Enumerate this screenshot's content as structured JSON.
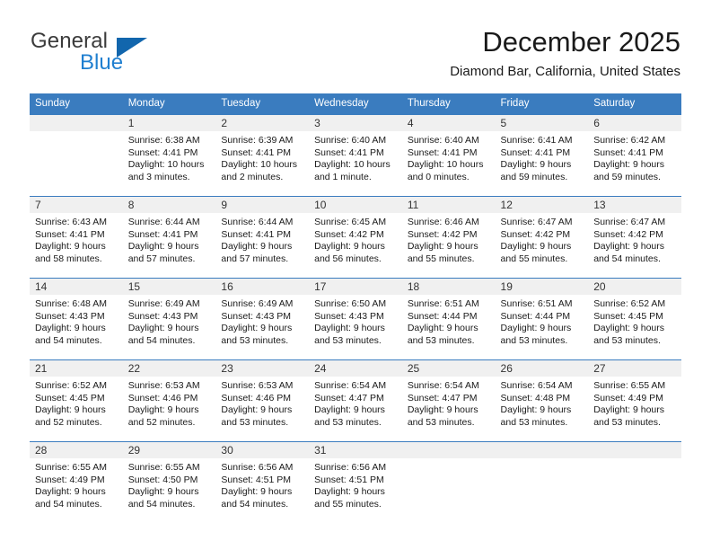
{
  "brand": {
    "name_part1": "General",
    "name_part2": "Blue",
    "logo_icon": "blue-triangle-logo"
  },
  "header": {
    "month_title": "December 2025",
    "location": "Diamond Bar, California, United States"
  },
  "calendar": {
    "weekday_headers": [
      "Sunday",
      "Monday",
      "Tuesday",
      "Wednesday",
      "Thursday",
      "Friday",
      "Saturday"
    ],
    "accent_color": "#3a7cbf",
    "band_color": "#f0f0f0",
    "weeks": [
      [
        {
          "day": "",
          "sunrise": "",
          "sunset": "",
          "daylight_line1": "",
          "daylight_line2": ""
        },
        {
          "day": "1",
          "sunrise": "Sunrise: 6:38 AM",
          "sunset": "Sunset: 4:41 PM",
          "daylight_line1": "Daylight: 10 hours",
          "daylight_line2": "and 3 minutes."
        },
        {
          "day": "2",
          "sunrise": "Sunrise: 6:39 AM",
          "sunset": "Sunset: 4:41 PM",
          "daylight_line1": "Daylight: 10 hours",
          "daylight_line2": "and 2 minutes."
        },
        {
          "day": "3",
          "sunrise": "Sunrise: 6:40 AM",
          "sunset": "Sunset: 4:41 PM",
          "daylight_line1": "Daylight: 10 hours",
          "daylight_line2": "and 1 minute."
        },
        {
          "day": "4",
          "sunrise": "Sunrise: 6:40 AM",
          "sunset": "Sunset: 4:41 PM",
          "daylight_line1": "Daylight: 10 hours",
          "daylight_line2": "and 0 minutes."
        },
        {
          "day": "5",
          "sunrise": "Sunrise: 6:41 AM",
          "sunset": "Sunset: 4:41 PM",
          "daylight_line1": "Daylight: 9 hours",
          "daylight_line2": "and 59 minutes."
        },
        {
          "day": "6",
          "sunrise": "Sunrise: 6:42 AM",
          "sunset": "Sunset: 4:41 PM",
          "daylight_line1": "Daylight: 9 hours",
          "daylight_line2": "and 59 minutes."
        }
      ],
      [
        {
          "day": "7",
          "sunrise": "Sunrise: 6:43 AM",
          "sunset": "Sunset: 4:41 PM",
          "daylight_line1": "Daylight: 9 hours",
          "daylight_line2": "and 58 minutes."
        },
        {
          "day": "8",
          "sunrise": "Sunrise: 6:44 AM",
          "sunset": "Sunset: 4:41 PM",
          "daylight_line1": "Daylight: 9 hours",
          "daylight_line2": "and 57 minutes."
        },
        {
          "day": "9",
          "sunrise": "Sunrise: 6:44 AM",
          "sunset": "Sunset: 4:41 PM",
          "daylight_line1": "Daylight: 9 hours",
          "daylight_line2": "and 57 minutes."
        },
        {
          "day": "10",
          "sunrise": "Sunrise: 6:45 AM",
          "sunset": "Sunset: 4:42 PM",
          "daylight_line1": "Daylight: 9 hours",
          "daylight_line2": "and 56 minutes."
        },
        {
          "day": "11",
          "sunrise": "Sunrise: 6:46 AM",
          "sunset": "Sunset: 4:42 PM",
          "daylight_line1": "Daylight: 9 hours",
          "daylight_line2": "and 55 minutes."
        },
        {
          "day": "12",
          "sunrise": "Sunrise: 6:47 AM",
          "sunset": "Sunset: 4:42 PM",
          "daylight_line1": "Daylight: 9 hours",
          "daylight_line2": "and 55 minutes."
        },
        {
          "day": "13",
          "sunrise": "Sunrise: 6:47 AM",
          "sunset": "Sunset: 4:42 PM",
          "daylight_line1": "Daylight: 9 hours",
          "daylight_line2": "and 54 minutes."
        }
      ],
      [
        {
          "day": "14",
          "sunrise": "Sunrise: 6:48 AM",
          "sunset": "Sunset: 4:43 PM",
          "daylight_line1": "Daylight: 9 hours",
          "daylight_line2": "and 54 minutes."
        },
        {
          "day": "15",
          "sunrise": "Sunrise: 6:49 AM",
          "sunset": "Sunset: 4:43 PM",
          "daylight_line1": "Daylight: 9 hours",
          "daylight_line2": "and 54 minutes."
        },
        {
          "day": "16",
          "sunrise": "Sunrise: 6:49 AM",
          "sunset": "Sunset: 4:43 PM",
          "daylight_line1": "Daylight: 9 hours",
          "daylight_line2": "and 53 minutes."
        },
        {
          "day": "17",
          "sunrise": "Sunrise: 6:50 AM",
          "sunset": "Sunset: 4:43 PM",
          "daylight_line1": "Daylight: 9 hours",
          "daylight_line2": "and 53 minutes."
        },
        {
          "day": "18",
          "sunrise": "Sunrise: 6:51 AM",
          "sunset": "Sunset: 4:44 PM",
          "daylight_line1": "Daylight: 9 hours",
          "daylight_line2": "and 53 minutes."
        },
        {
          "day": "19",
          "sunrise": "Sunrise: 6:51 AM",
          "sunset": "Sunset: 4:44 PM",
          "daylight_line1": "Daylight: 9 hours",
          "daylight_line2": "and 53 minutes."
        },
        {
          "day": "20",
          "sunrise": "Sunrise: 6:52 AM",
          "sunset": "Sunset: 4:45 PM",
          "daylight_line1": "Daylight: 9 hours",
          "daylight_line2": "and 53 minutes."
        }
      ],
      [
        {
          "day": "21",
          "sunrise": "Sunrise: 6:52 AM",
          "sunset": "Sunset: 4:45 PM",
          "daylight_line1": "Daylight: 9 hours",
          "daylight_line2": "and 52 minutes."
        },
        {
          "day": "22",
          "sunrise": "Sunrise: 6:53 AM",
          "sunset": "Sunset: 4:46 PM",
          "daylight_line1": "Daylight: 9 hours",
          "daylight_line2": "and 52 minutes."
        },
        {
          "day": "23",
          "sunrise": "Sunrise: 6:53 AM",
          "sunset": "Sunset: 4:46 PM",
          "daylight_line1": "Daylight: 9 hours",
          "daylight_line2": "and 53 minutes."
        },
        {
          "day": "24",
          "sunrise": "Sunrise: 6:54 AM",
          "sunset": "Sunset: 4:47 PM",
          "daylight_line1": "Daylight: 9 hours",
          "daylight_line2": "and 53 minutes."
        },
        {
          "day": "25",
          "sunrise": "Sunrise: 6:54 AM",
          "sunset": "Sunset: 4:47 PM",
          "daylight_line1": "Daylight: 9 hours",
          "daylight_line2": "and 53 minutes."
        },
        {
          "day": "26",
          "sunrise": "Sunrise: 6:54 AM",
          "sunset": "Sunset: 4:48 PM",
          "daylight_line1": "Daylight: 9 hours",
          "daylight_line2": "and 53 minutes."
        },
        {
          "day": "27",
          "sunrise": "Sunrise: 6:55 AM",
          "sunset": "Sunset: 4:49 PM",
          "daylight_line1": "Daylight: 9 hours",
          "daylight_line2": "and 53 minutes."
        }
      ],
      [
        {
          "day": "28",
          "sunrise": "Sunrise: 6:55 AM",
          "sunset": "Sunset: 4:49 PM",
          "daylight_line1": "Daylight: 9 hours",
          "daylight_line2": "and 54 minutes."
        },
        {
          "day": "29",
          "sunrise": "Sunrise: 6:55 AM",
          "sunset": "Sunset: 4:50 PM",
          "daylight_line1": "Daylight: 9 hours",
          "daylight_line2": "and 54 minutes."
        },
        {
          "day": "30",
          "sunrise": "Sunrise: 6:56 AM",
          "sunset": "Sunset: 4:51 PM",
          "daylight_line1": "Daylight: 9 hours",
          "daylight_line2": "and 54 minutes."
        },
        {
          "day": "31",
          "sunrise": "Sunrise: 6:56 AM",
          "sunset": "Sunset: 4:51 PM",
          "daylight_line1": "Daylight: 9 hours",
          "daylight_line2": "and 55 minutes."
        },
        {
          "day": "",
          "sunrise": "",
          "sunset": "",
          "daylight_line1": "",
          "daylight_line2": ""
        },
        {
          "day": "",
          "sunrise": "",
          "sunset": "",
          "daylight_line1": "",
          "daylight_line2": ""
        },
        {
          "day": "",
          "sunrise": "",
          "sunset": "",
          "daylight_line1": "",
          "daylight_line2": ""
        }
      ]
    ]
  }
}
